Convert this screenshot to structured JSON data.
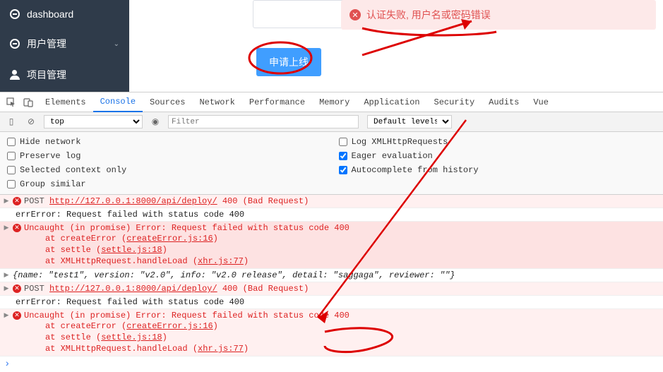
{
  "sidebar": {
    "items": [
      {
        "label": "dashboard",
        "icon": "circle",
        "hasChev": false
      },
      {
        "label": "用户管理",
        "icon": "circle",
        "hasChev": true
      },
      {
        "label": "项目管理",
        "icon": "user",
        "hasChev": false
      }
    ]
  },
  "alert": {
    "text": "认证失败, 用户名或密码错误"
  },
  "button": {
    "submit_label": "申请上线"
  },
  "devtools": {
    "tabs": [
      "Elements",
      "Console",
      "Sources",
      "Network",
      "Performance",
      "Memory",
      "Application",
      "Security",
      "Audits",
      "Vue"
    ],
    "active_tab": "Console",
    "context": "top",
    "filter_placeholder": "Filter",
    "levels": "Default levels",
    "settings_left": [
      {
        "label": "Hide network",
        "checked": false
      },
      {
        "label": "Preserve log",
        "checked": false
      },
      {
        "label": "Selected context only",
        "checked": false
      },
      {
        "label": "Group similar",
        "checked": false
      }
    ],
    "settings_right": [
      {
        "label": "Log XMLHttpRequests",
        "checked": false
      },
      {
        "label": "Eager evaluation",
        "checked": true
      },
      {
        "label": "Autocomplete from history",
        "checked": true
      }
    ]
  },
  "console": {
    "rows": [
      {
        "type": "error",
        "expand": true,
        "icon": true,
        "html": "<span class='tri'>▶</span><span class='erricon'>✕</span><span class='rtxt'><span class='method'>POST</span> <a>http://127.0.0.1:8000/api/deploy/</a> <span class='badreq'>400 (Bad Request)</span></span>"
      },
      {
        "type": "normal",
        "html": "<span style='width:14px'></span><span class='rtxt'>errError: Request failed with status code 400</span>"
      },
      {
        "type": "errorsel",
        "html": "<span class='tri'>▶</span><span class='erricon'>✕</span><span class='rtxt'>Uncaught (in promise) Error: Request failed with status code 400\n<span class='indent'>at createError (<a>createError.js:16</a>)</span>\n<span class='indent'>at settle (<a>settle.js:18</a>)</span>\n<span class='indent'>at XMLHttpRequest.handleLoad (<a>xhr.js:77</a>)</span></span>"
      },
      {
        "type": "normal",
        "html": "<span class='tri'>▶</span><span class='rtxt'><i>{name: \"test1\", version: \"v2.0\", info: \"v2.0 release\", detail: \"saggaga\", reviewer: \"\"}</i></span>"
      },
      {
        "type": "error",
        "html": "<span class='tri'>▶</span><span class='erricon'>✕</span><span class='rtxt'><span class='method'>POST</span> <a>http://127.0.0.1:8000/api/deploy/</a> <span class='badreq'>400 (Bad Request)</span></span>"
      },
      {
        "type": "normal",
        "html": "<span style='width:14px'></span><span class='rtxt'>errError: Request failed with status code 400</span>"
      },
      {
        "type": "error",
        "html": "<span class='tri'>▶</span><span class='erricon'>✕</span><span class='rtxt'>Uncaught (in promise) Error: Request failed with status code 400\n<span class='indent'>at createError (<a>createError.js:16</a>)</span>\n<span class='indent'>at settle (<a>settle.js:18</a>)</span>\n<span class='indent'>at XMLHttpRequest.handleLoad (<a>xhr.js:77</a>)</span></span>"
      }
    ]
  }
}
